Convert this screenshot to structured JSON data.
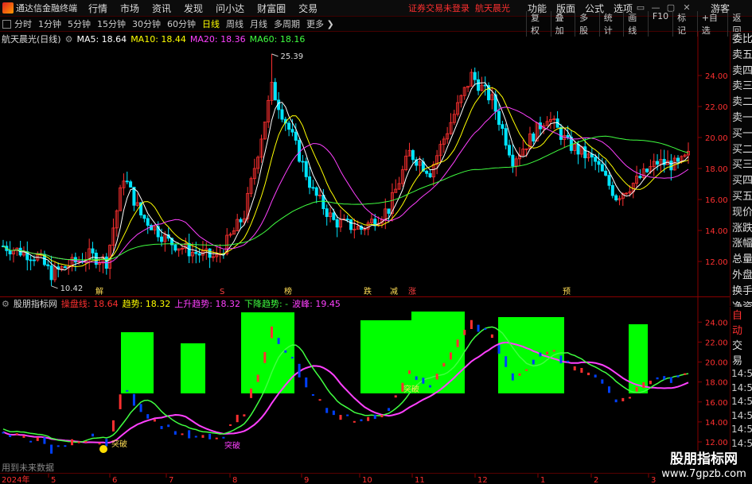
{
  "menubar": {
    "app_name": "通达信金融终端",
    "items": [
      "行情",
      "市场",
      "资讯",
      "发现",
      "问小达",
      "财富圈",
      "交易"
    ],
    "status_text": "证券交易未登录",
    "stock_name_title": "航天晨光",
    "right_items": [
      "功能",
      "版面",
      "公式",
      "选项"
    ],
    "guest": "游客"
  },
  "periodbar": {
    "periods": [
      "分时",
      "1分钟",
      "5分钟",
      "15分钟",
      "30分钟",
      "60分钟",
      "日线",
      "周线",
      "月线",
      "多周期",
      "更多"
    ],
    "active": "日线",
    "right_tools": [
      "复权",
      "叠加",
      "多股",
      "统计",
      "画线",
      "F10",
      "标记",
      "+自选",
      "返回"
    ]
  },
  "main_chart": {
    "title": "航天晨光(日线)",
    "ma_labels": [
      {
        "text": "MA5: 18.64",
        "color": "#ffffff"
      },
      {
        "text": "MA10: 18.44",
        "color": "#ffff00"
      },
      {
        "text": "MA20: 18.36",
        "color": "#ff40ff"
      },
      {
        "text": "MA60: 18.16",
        "color": "#40ff40"
      }
    ],
    "y_ticks": [
      "24.00",
      "22.00",
      "20.00",
      "18.00",
      "16.00",
      "14.00",
      "12.00"
    ],
    "high_label": "25.39",
    "low_label": "10.42",
    "event_tags": [
      "解",
      "S",
      "榜",
      "跌",
      "减",
      "涨",
      "预"
    ]
  },
  "indicator_chart": {
    "title": "股朋指标网",
    "labels": [
      {
        "text": "操盘线: 18.64",
        "color": "#ff3030"
      },
      {
        "text": "趋势: 18.32",
        "color": "#ffff00"
      },
      {
        "text": "上升趋势: 18.32",
        "color": "#ff40ff"
      },
      {
        "text": "下降趋势: -",
        "color": "#40ff40"
      },
      {
        "text": "波峰: 19.45",
        "color": "#ff40ff"
      }
    ],
    "y_ticks": [
      "24.00",
      "22.00",
      "20.00",
      "18.00",
      "16.00",
      "14.00",
      "12.00"
    ],
    "annotations": [
      "突破",
      "突破",
      "突破"
    ]
  },
  "right_panel": {
    "items": [
      "委比",
      "卖五",
      "卖四",
      "卖三",
      "卖二",
      "卖一",
      "买一",
      "买二",
      "买三",
      "买四",
      "买五",
      "现价",
      "涨跌",
      "涨幅",
      "总量",
      "外盘",
      "换手",
      "净资",
      "收益"
    ],
    "lower_title1": "自动",
    "lower_title2": "交易",
    "times": [
      "14:56",
      "14:56",
      "14:56",
      "14:56",
      "14:56",
      "14:56",
      "14:56",
      "14:56",
      "14:56"
    ]
  },
  "x_axis": {
    "labels": [
      "2024年",
      "5",
      "6",
      "7",
      "8",
      "9",
      "10",
      "11",
      "12",
      "1",
      "2",
      "3"
    ]
  },
  "footnote": "用到未来数据",
  "watermark": {
    "line1": "股朋指标网",
    "line2": "www.7gpzb.com"
  },
  "colors": {
    "up": "#ff3030",
    "down": "#00e5ff",
    "bg": "#000000",
    "box": "#00ff00"
  }
}
